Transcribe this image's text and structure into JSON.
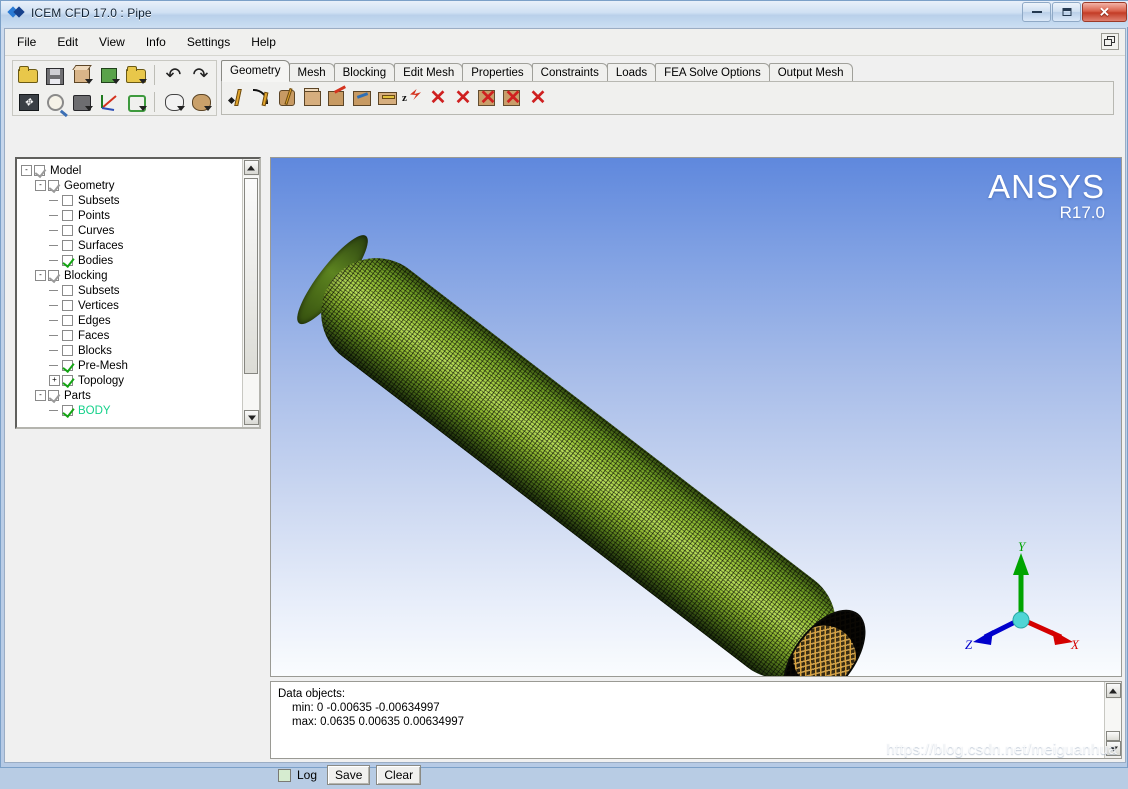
{
  "window": {
    "title": "ICEM CFD 17.0 : Pipe",
    "app_icon": "icem-diamond-icon",
    "controls": {
      "minimize": "minimize-icon",
      "maximize": "restore-icon",
      "close": "✕"
    }
  },
  "menubar": {
    "items": [
      "File",
      "Edit",
      "View",
      "Info",
      "Settings",
      "Help"
    ],
    "restore_icon": "cascade-windows-icon"
  },
  "toolbar": {
    "row1": [
      {
        "name": "open-project-button",
        "icon": "folder-open-icon"
      },
      {
        "name": "save-project-button",
        "icon": "floppy-disk-icon"
      },
      {
        "name": "open-geometry-button",
        "icon": "folder-geometry-icon"
      },
      {
        "name": "open-mesh-button",
        "icon": "folder-mesh-icon"
      },
      {
        "name": "open-blocking-button",
        "icon": "folder-blocking-icon"
      },
      {
        "name": "undo-button",
        "icon": "undo-arrow-icon"
      },
      {
        "name": "redo-button",
        "icon": "redo-arrow-icon"
      }
    ],
    "row2": [
      {
        "name": "fit-window-button",
        "icon": "fit-view-icon"
      },
      {
        "name": "zoom-box-button",
        "icon": "magnifier-icon"
      },
      {
        "name": "measure-button",
        "icon": "measure-icon"
      },
      {
        "name": "local-coordinate-button",
        "icon": "lcs-axes-icon"
      },
      {
        "name": "replay-button",
        "icon": "refresh-cycle-icon"
      },
      {
        "name": "view-mode-button",
        "icon": "view-cube-icon"
      },
      {
        "name": "solid-view-button",
        "icon": "solid-cube-icon"
      }
    ]
  },
  "tabs": {
    "active": "Geometry",
    "items": [
      "Geometry",
      "Mesh",
      "Blocking",
      "Edit Mesh",
      "Properties",
      "Constraints",
      "Loads",
      "FEA Solve Options",
      "Output Mesh"
    ]
  },
  "geometry_tools": [
    {
      "name": "create-point-button",
      "icon": "create-point-icon"
    },
    {
      "name": "create-curve-button",
      "icon": "create-curve-icon"
    },
    {
      "name": "create-surface-button",
      "icon": "create-surface-icon"
    },
    {
      "name": "create-body-button",
      "icon": "create-body-icon"
    },
    {
      "name": "transform-geometry-button",
      "icon": "transform-geometry-icon"
    },
    {
      "name": "repair-geometry-button",
      "icon": "repair-geometry-icon"
    },
    {
      "name": "create-midsurface-button",
      "icon": "midsurface-icon"
    },
    {
      "name": "transform-z-button",
      "icon": "translate-z-icon"
    },
    {
      "name": "delete-point-button",
      "icon": "delete-point-icon"
    },
    {
      "name": "delete-curve-button",
      "icon": "delete-curve-icon"
    },
    {
      "name": "delete-surface-button",
      "icon": "delete-surface-icon"
    },
    {
      "name": "delete-body-button",
      "icon": "delete-body-icon"
    },
    {
      "name": "delete-any-button",
      "icon": "delete-icon"
    }
  ],
  "tree": {
    "nodes": [
      {
        "label": "Model",
        "depth": 0,
        "expander": "-",
        "check": "grey",
        "teal": false
      },
      {
        "label": "Geometry",
        "depth": 1,
        "expander": "-",
        "check": "grey",
        "teal": false
      },
      {
        "label": "Subsets",
        "depth": 2,
        "expander": "",
        "check": "empty",
        "teal": false
      },
      {
        "label": "Points",
        "depth": 2,
        "expander": "",
        "check": "empty",
        "teal": false
      },
      {
        "label": "Curves",
        "depth": 2,
        "expander": "",
        "check": "empty",
        "teal": false
      },
      {
        "label": "Surfaces",
        "depth": 2,
        "expander": "",
        "check": "empty",
        "teal": false
      },
      {
        "label": "Bodies",
        "depth": 2,
        "expander": "",
        "check": "green",
        "teal": false
      },
      {
        "label": "Blocking",
        "depth": 1,
        "expander": "-",
        "check": "grey",
        "teal": false
      },
      {
        "label": "Subsets",
        "depth": 2,
        "expander": "",
        "check": "empty",
        "teal": false
      },
      {
        "label": "Vertices",
        "depth": 2,
        "expander": "",
        "check": "empty",
        "teal": false
      },
      {
        "label": "Edges",
        "depth": 2,
        "expander": "",
        "check": "empty",
        "teal": false
      },
      {
        "label": "Faces",
        "depth": 2,
        "expander": "",
        "check": "empty",
        "teal": false
      },
      {
        "label": "Blocks",
        "depth": 2,
        "expander": "",
        "check": "empty",
        "teal": false
      },
      {
        "label": "Pre-Mesh",
        "depth": 2,
        "expander": "",
        "check": "green",
        "teal": false
      },
      {
        "label": "Topology",
        "depth": 2,
        "expander": "+",
        "check": "green",
        "teal": false
      },
      {
        "label": "Parts",
        "depth": 1,
        "expander": "-",
        "check": "grey",
        "teal": false
      },
      {
        "label": "BODY",
        "depth": 2,
        "expander": "",
        "check": "green",
        "teal": true
      }
    ],
    "scrollbar": {
      "up": "scroll-up-arrow",
      "down": "scroll-down-arrow"
    }
  },
  "viewport": {
    "logo_main": "ANSYS",
    "logo_release": "R17.0",
    "background_top_color": "#5f88dd",
    "background_bottom_color": "#fafcfe",
    "mesh_color": "#9cc63c",
    "cap_color": "#d9a23c",
    "triad": {
      "x_label": "X",
      "y_label": "Y",
      "z_label": "Z",
      "x_color": "#d40000",
      "y_color": "#00a400",
      "z_color": "#0000cc",
      "origin_color": "#4fd5d5"
    }
  },
  "log": {
    "lines": [
      {
        "text": "Data objects:",
        "indent": false
      },
      {
        "text": "min: 0 -0.00635 -0.00634997",
        "indent": true
      },
      {
        "text": "max: 0.0635 0.00635 0.00634997",
        "indent": true
      }
    ],
    "checkbox_label": "Log",
    "save_label": "Save",
    "clear_label": "Clear"
  },
  "watermark": "https://blog.csdn.net/meiguanhua"
}
